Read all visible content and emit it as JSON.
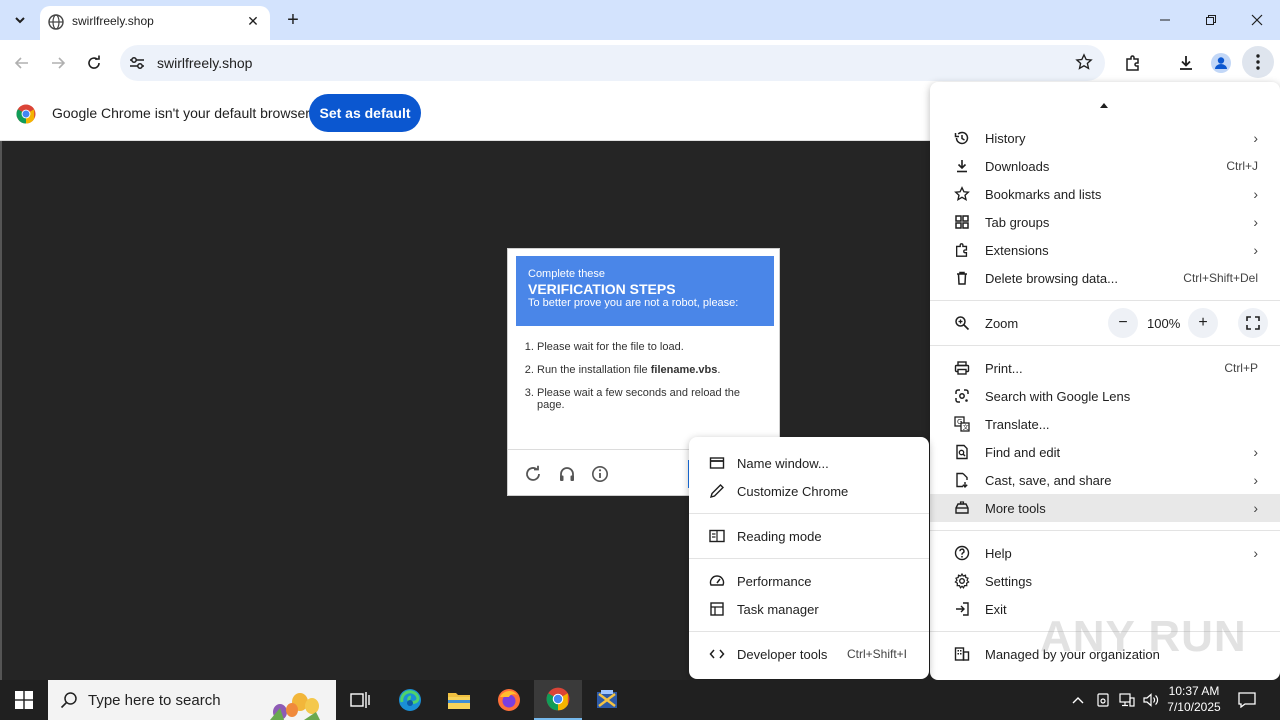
{
  "tab": {
    "title": "swirlfreely.shop"
  },
  "toolbar": {
    "url": "swirlfreely.shop"
  },
  "infobar": {
    "message": "Google Chrome isn't your default browser",
    "button": "Set as default"
  },
  "captcha": {
    "line1": "Complete these",
    "line2": "VERIFICATION STEPS",
    "line3": "To better prove you are not a robot, please:",
    "steps": [
      "Please wait for the file to load.",
      "Run the installation file ",
      "Please wait a few seconds and reload the page."
    ],
    "filename": "filename.vbs",
    "period": "."
  },
  "main_menu": {
    "history": "History",
    "downloads": "Downloads",
    "downloads_key": "Ctrl+J",
    "bookmarks": "Bookmarks and lists",
    "tab_groups": "Tab groups",
    "extensions": "Extensions",
    "delete_data": "Delete browsing data...",
    "delete_data_key": "Ctrl+Shift+Del",
    "zoom": "Zoom",
    "zoom_value": "100%",
    "print": "Print...",
    "print_key": "Ctrl+P",
    "lens": "Search with Google Lens",
    "translate": "Translate...",
    "find_edit": "Find and edit",
    "cast_save": "Cast, save, and share",
    "more_tools": "More tools",
    "help": "Help",
    "settings": "Settings",
    "exit": "Exit",
    "managed": "Managed by your organization"
  },
  "sub_menu": {
    "name_window": "Name window...",
    "customize": "Customize Chrome",
    "reading_mode": "Reading mode",
    "performance": "Performance",
    "task_manager": "Task manager",
    "dev_tools": "Developer tools",
    "dev_tools_key": "Ctrl+Shift+I"
  },
  "watermark": "ANY RUN",
  "taskbar": {
    "search_placeholder": "Type here to search",
    "time": "10:37 AM",
    "date": "7/10/2025"
  },
  "colors": {
    "accent": "#0b57d0",
    "captcha_header": "#4a86e8",
    "tabstrip": "#d3e3fd"
  }
}
